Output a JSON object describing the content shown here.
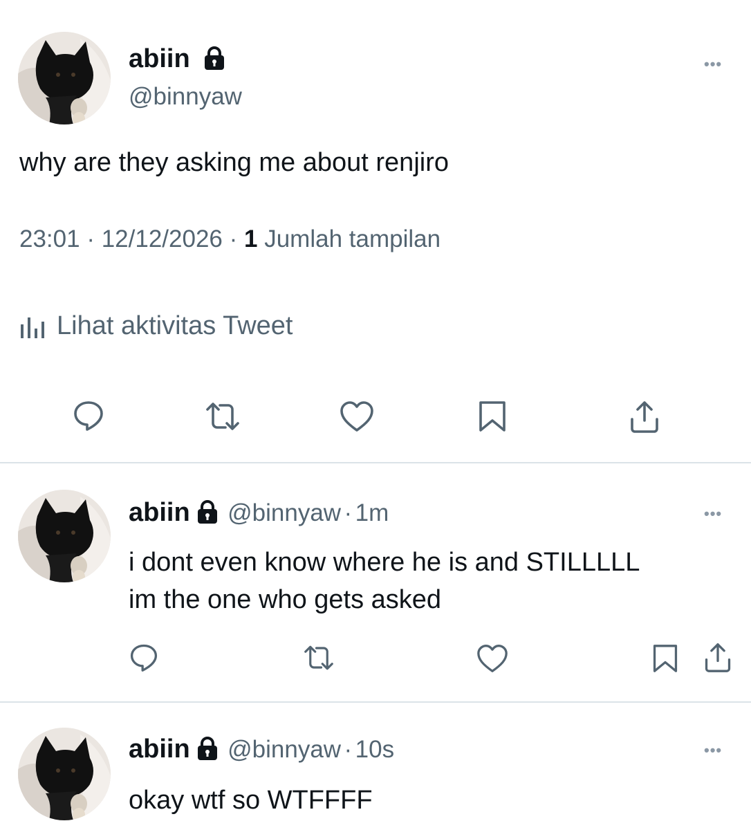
{
  "main_tweet": {
    "author_name": "abiin",
    "author_handle": "@binnyaw",
    "text": "why are they asking me about renjiro",
    "time": "23:01",
    "date": "12/12/2026",
    "views_count": "1",
    "views_label": "Jumlah tampilan",
    "activity_label": "Lihat aktivitas Tweet",
    "icons": [
      "reply-icon",
      "retweet-icon",
      "like-icon",
      "bookmark-icon",
      "share-icon"
    ]
  },
  "replies": [
    {
      "author_name": "abiin",
      "author_handle": "@binnyaw",
      "time_ago": "1m",
      "lines": [
        "i dont even know where he is and STILLLLL",
        "im the one who gets asked"
      ]
    },
    {
      "author_name": "abiin",
      "author_handle": "@binnyaw",
      "time_ago": "10s",
      "lines": [
        "okay wtf so WTFFFF"
      ]
    }
  ],
  "separator": "·",
  "more_label": "•••",
  "colors": {
    "text": "#0f1419",
    "secondary": "#536471",
    "icon": "#536471",
    "divider": "#dbe3e8"
  }
}
